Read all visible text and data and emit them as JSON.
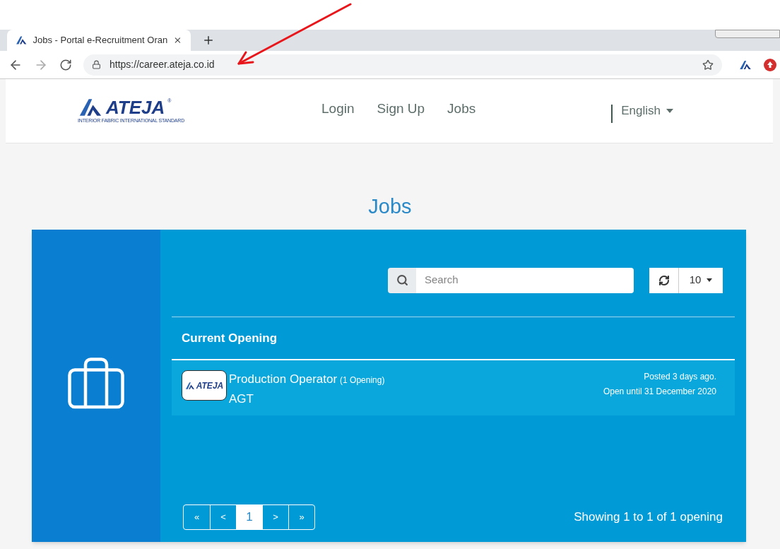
{
  "browser": {
    "tab_title": "Jobs - Portal e-Recruitment Oran",
    "url": "https://career.ateja.co.id"
  },
  "header": {
    "logo": {
      "name": "ATEJA",
      "mark": "®",
      "tagline": "INTERIOR FABRIC INTERNATIONAL STANDARD"
    },
    "nav": [
      "Login",
      "Sign Up",
      "Jobs"
    ],
    "language": "English"
  },
  "page_title": "Jobs",
  "toolbar": {
    "search": {
      "placeholder": "Search"
    },
    "page_size": "10"
  },
  "section_title": "Current Opening",
  "jobs": [
    {
      "logo": "ATEJA",
      "title": "Production Operator",
      "openings": "(1 Opening)",
      "location": "AGT",
      "posted": "Posted 3 days ago.",
      "open_until": "Open until 31 December 2020"
    }
  ],
  "pagination": [
    {
      "label": "«",
      "selected": false
    },
    {
      "label": "<",
      "selected": false
    },
    {
      "label": "1",
      "selected": true
    },
    {
      "label": ">",
      "selected": false
    },
    {
      "label": "»",
      "selected": false
    }
  ],
  "summary": "Showing 1 to 1 of 1 opening"
}
